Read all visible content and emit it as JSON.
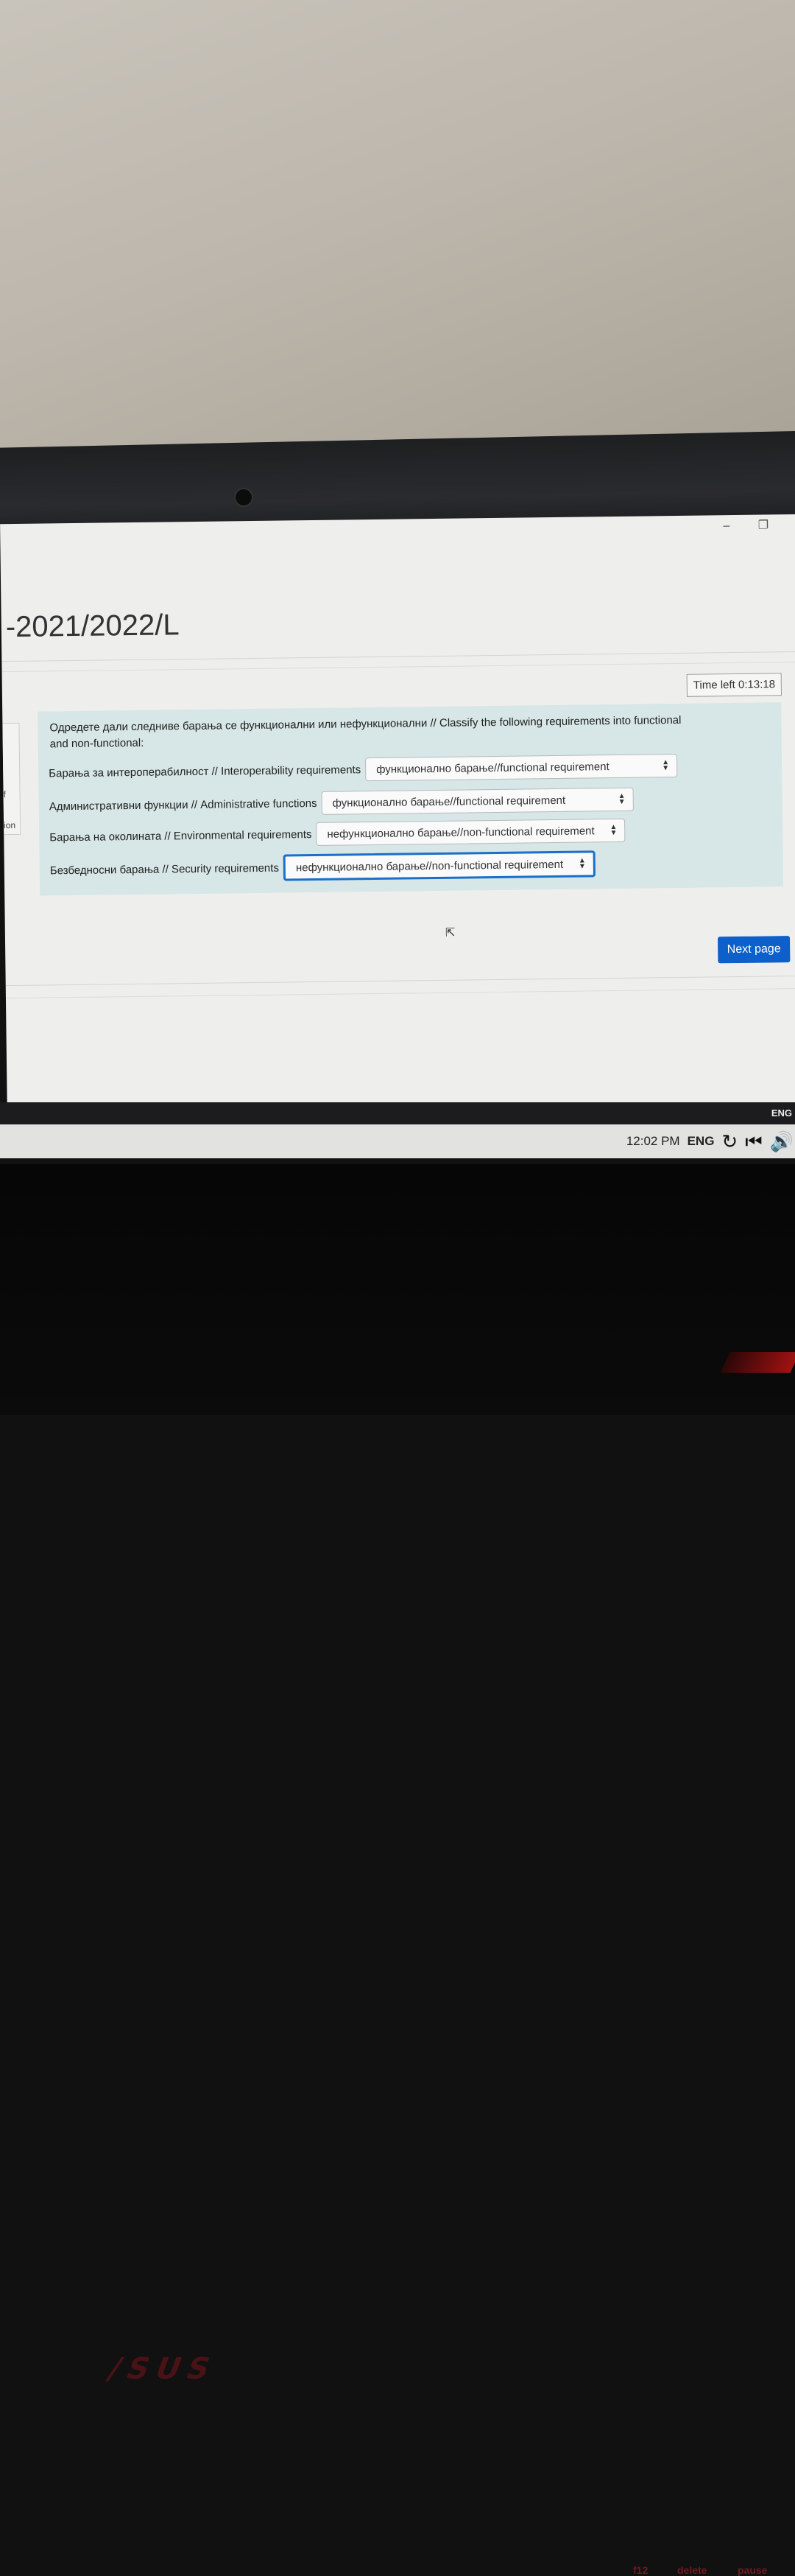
{
  "window": {
    "minimize_icon": "–",
    "restore_icon": "❐"
  },
  "course": {
    "title": "-2021/2022/L"
  },
  "timer": {
    "text": "Time left 0:13:18"
  },
  "sidebar_stub": {
    "text1": "f",
    "text2": "ion"
  },
  "question": {
    "prompt": "Одредете дали следниве барања се функционални или нефункционални // Classify the following requirements into functional and non-functional:",
    "rows": [
      {
        "label": "Барања за интероперабилност // Interoperability requirements",
        "selected": "функционално барање//functional requirement"
      },
      {
        "label": "Административни функции // Administrative functions",
        "selected": "функционално барање//functional requirement"
      },
      {
        "label": "Барања на околината // Environmental requirements",
        "selected": "нефункционално барање//non-functional requirement"
      },
      {
        "label": "Безбедносни барања // Security requirements",
        "selected": "нефункционално барање//non-functional requirement"
      }
    ]
  },
  "navigation": {
    "next_label": "Next page"
  },
  "system": {
    "lang_top": "ENG",
    "time": "12:02 PM",
    "lang": "ENG",
    "icons": [
      "refresh-icon",
      "skip-back-icon",
      "volume-icon"
    ]
  },
  "keyboard": {
    "key_delete": "delete",
    "key_pause": "pause",
    "key_f12": "f12"
  },
  "colors": {
    "accent": "#0d5fc9",
    "question_bg": "#d7e6e6",
    "focus": "#1a6fc9"
  }
}
